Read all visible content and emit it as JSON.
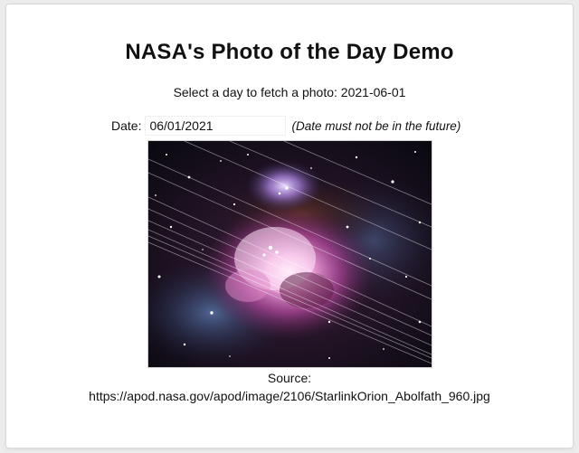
{
  "page": {
    "title": "NASA's Photo of the Day Demo",
    "subtitle": "Select a day to fetch a photo: 2021-06-01"
  },
  "date_picker": {
    "label": "Date:",
    "value": "06/01/2021",
    "note": "(Date must not be in the future)"
  },
  "photo": {
    "alt": "Orion Nebula with Starlink satellite trails"
  },
  "source": {
    "label": "Source:",
    "url": "https://apod.nasa.gov/apod/image/2106/StarlinkOrion_Abolfath_960.jpg"
  },
  "colors": {
    "background": "#ececec",
    "card": "#ffffff",
    "text": "#111111"
  }
}
